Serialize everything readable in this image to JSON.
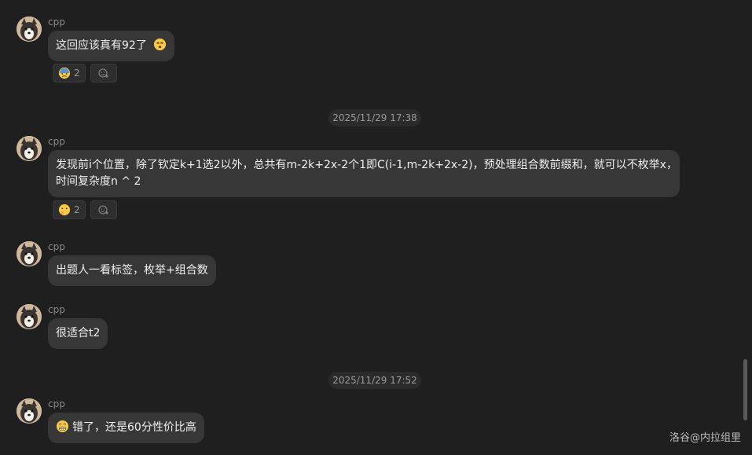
{
  "messages": [
    {
      "sender": "cpp",
      "text": "这回应该真有92了",
      "emoji": "dizzy-face-emoji",
      "reaction": {
        "emoji": "anxious-face-emoji",
        "count": "2"
      }
    },
    {
      "sender": "cpp",
      "line1": "发现前i个位置，除了钦定k+1选2以外，总共有m-2k+2x-2个1即C(i-1,m-2k+2x-2)，预处理组合数前缀和，就可以不枚举x，",
      "line2": "时间复杂度n ^ 2",
      "reaction": {
        "emoji": "thinking-hand-emoji",
        "count": "2"
      }
    },
    {
      "sender": "cpp",
      "text": "出题人一看标签，枚举+组合数"
    },
    {
      "sender": "cpp",
      "text": "很适合t2"
    },
    {
      "sender": "cpp",
      "text": "错了，还是60分性价比高",
      "emoji": "grimacing-face-emoji"
    }
  ],
  "timestamps": [
    "2025/11/29 17:38",
    "2025/11/29 17:52"
  ],
  "watermark": "洛谷@内拉组里",
  "colors": {
    "background": "#1f1f1f",
    "bubble": "#373737",
    "text": "#f0f0f0",
    "muted": "#8a8a8a"
  }
}
